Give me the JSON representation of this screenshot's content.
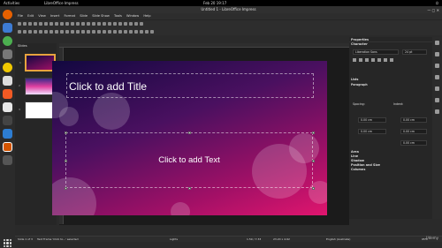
{
  "topbar": {
    "activities": "Activities",
    "app": "LibreOffice Impress",
    "clock": "Feb 20  19:17"
  },
  "window": {
    "title": "Untitled 1 - LibreOffice Impress"
  },
  "menu": [
    "File",
    "Edit",
    "View",
    "Insert",
    "Format",
    "Slide",
    "Slide Show",
    "Tools",
    "Window",
    "Help"
  ],
  "slides_pane": {
    "title": "Slides",
    "slides": [
      "1",
      "2",
      "3"
    ]
  },
  "slide": {
    "title_placeholder": "Click to add Title",
    "text_placeholder": "Click to add Text"
  },
  "sidebar": {
    "title": "Properties",
    "character": "Character",
    "font_name": "Liberation Sans",
    "font_size": "24 pt",
    "lists": "Lists",
    "paragraph": "Paragraph",
    "spacing": "Spacing:",
    "indent": "Indent:",
    "spacing_above": "0.00 cm",
    "spacing_below": "0.00 cm",
    "indent_before": "0.00 cm",
    "indent_after": "0.00 cm",
    "indent_first": "0.00 cm",
    "sections": [
      "Area",
      "Line",
      "Shadow",
      "Position and Size",
      "Columns"
    ]
  },
  "statusbar": {
    "slide": "Slide 1 of 3",
    "selection": "Text Frame 'Click to...' selected",
    "layout": "Lights",
    "position": "1.59 / 7.33",
    "size": "23.20 x 4.62",
    "language": "English (Australia)",
    "zoom": "95%"
  },
  "watermark": "Udemy"
}
